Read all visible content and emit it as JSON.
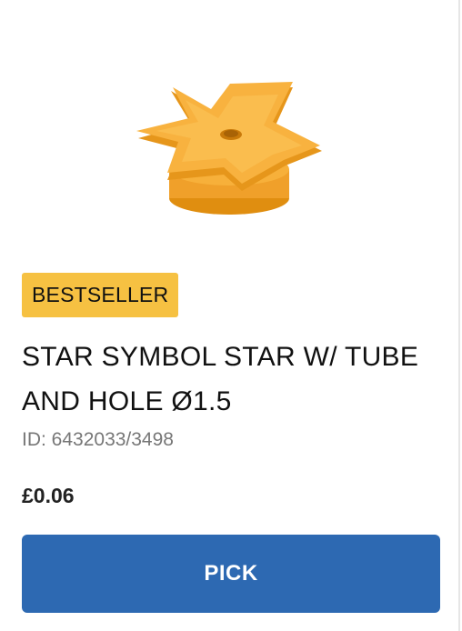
{
  "product": {
    "image_alt": "star-symbol-star-product-image",
    "badge": "BESTSELLER",
    "title_line1": "STAR SYMBOL STAR W/ TUBE",
    "title_line2": "AND HOLE Ø1.5",
    "id_text": "ID: 6432033/3498",
    "price": "£0.06",
    "button_label": "PICK"
  },
  "colors": {
    "badge_bg": "#f6c142",
    "button_bg": "#2d69b2",
    "product_orange": "#f5a623"
  }
}
